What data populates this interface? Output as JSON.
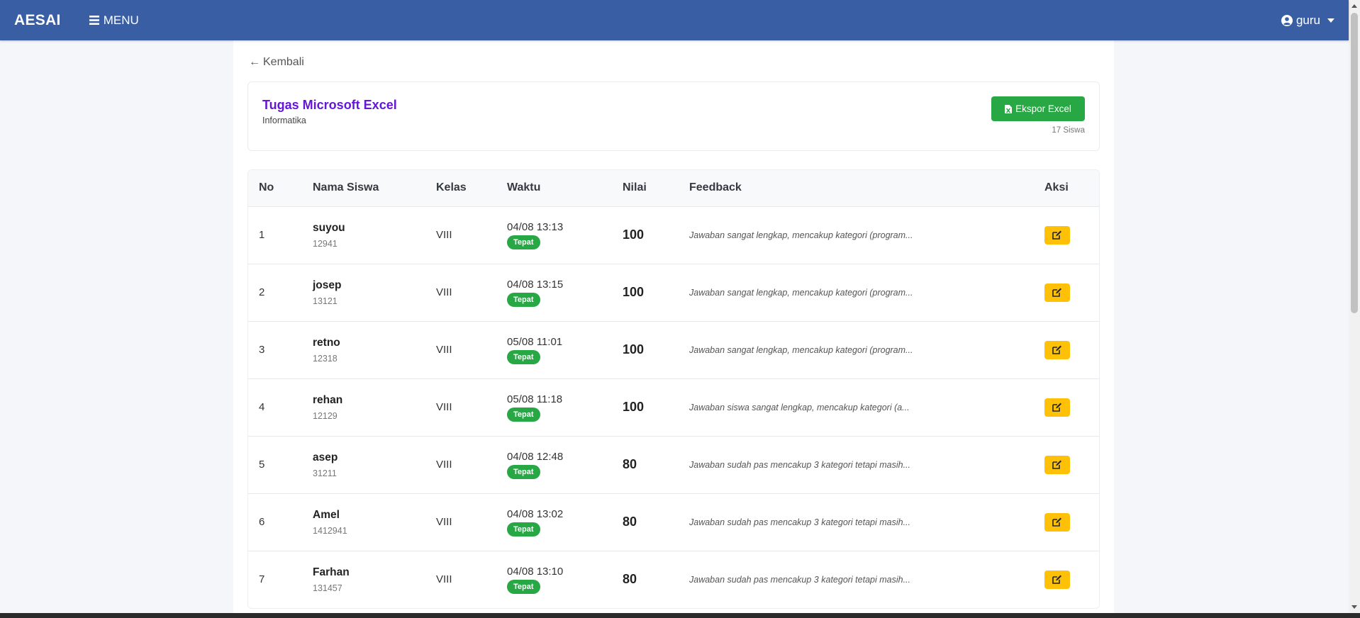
{
  "navbar": {
    "brand": "AESAI",
    "menu_label": "MENU",
    "user_label": "guru"
  },
  "back_link": "Kembali",
  "assignment": {
    "title": "Tugas Microsoft Excel",
    "subject": "Informatika",
    "export_label": "Ekspor Excel",
    "count_label": "17 Siswa"
  },
  "table": {
    "headers": {
      "no": "No",
      "name": "Nama Siswa",
      "kelas": "Kelas",
      "waktu": "Waktu",
      "nilai": "Nilai",
      "feedback": "Feedback",
      "aksi": "Aksi"
    },
    "rows": [
      {
        "no": "1",
        "name": "suyou",
        "nis": "12941",
        "kelas": "VIII",
        "time": "04/08 13:13",
        "status": "Tepat",
        "score": "100",
        "feedback": "Jawaban sangat lengkap, mencakup kategori (program..."
      },
      {
        "no": "2",
        "name": "josep",
        "nis": "13121",
        "kelas": "VIII",
        "time": "04/08 13:15",
        "status": "Tepat",
        "score": "100",
        "feedback": "Jawaban sangat lengkap, mencakup kategori (program..."
      },
      {
        "no": "3",
        "name": "retno",
        "nis": "12318",
        "kelas": "VIII",
        "time": "05/08 11:01",
        "status": "Tepat",
        "score": "100",
        "feedback": "Jawaban sangat lengkap, mencakup kategori (program..."
      },
      {
        "no": "4",
        "name": "rehan",
        "nis": "12129",
        "kelas": "VIII",
        "time": "05/08 11:18",
        "status": "Tepat",
        "score": "100",
        "feedback": "Jawaban siswa sangat lengkap, mencakup kategori (a..."
      },
      {
        "no": "5",
        "name": "asep",
        "nis": "31211",
        "kelas": "VIII",
        "time": "04/08 12:48",
        "status": "Tepat",
        "score": "80",
        "feedback": "Jawaban sudah pas mencakup 3 kategori tetapi masih..."
      },
      {
        "no": "6",
        "name": "Amel",
        "nis": "1412941",
        "kelas": "VIII",
        "time": "04/08 13:02",
        "status": "Tepat",
        "score": "80",
        "feedback": "Jawaban sudah pas mencakup 3 kategori tetapi masih..."
      },
      {
        "no": "7",
        "name": "Farhan",
        "nis": "131457",
        "kelas": "VIII",
        "time": "04/08 13:10",
        "status": "Tepat",
        "score": "80",
        "feedback": "Jawaban sudah pas mencakup 3 kategori tetapi masih..."
      }
    ]
  },
  "icons": {
    "menu": "bars-icon",
    "user": "user-circle-icon",
    "export": "file-excel-icon",
    "edit": "edit-icon",
    "back": "arrow-left-icon"
  },
  "colors": {
    "navbar": "#3a5ea4",
    "title": "#6417d6",
    "success": "#28a745",
    "warning": "#ffc107"
  }
}
